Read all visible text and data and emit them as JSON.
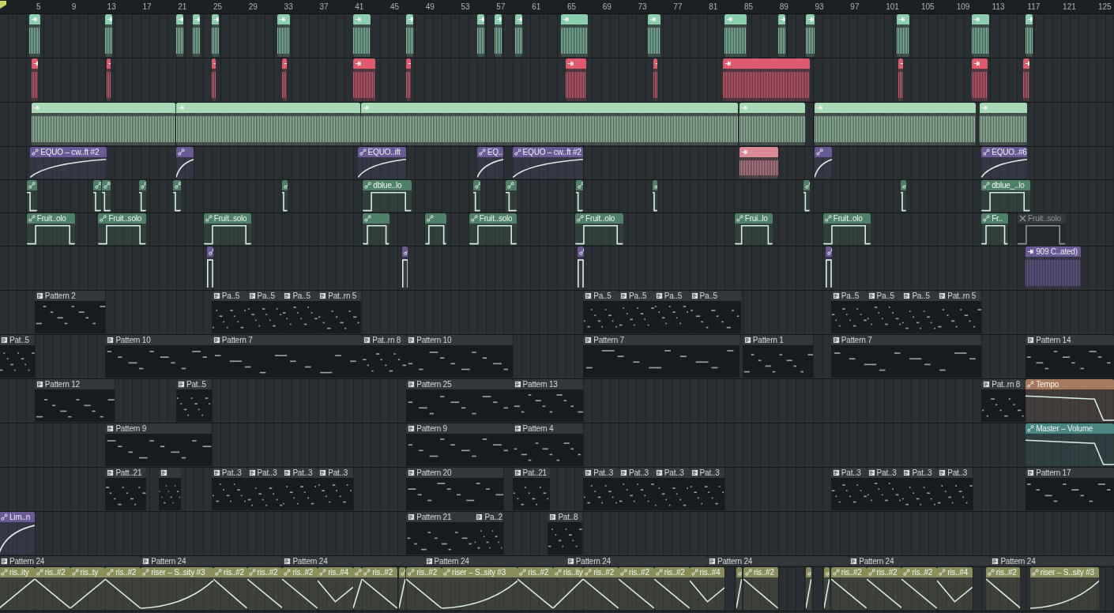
{
  "ruler": [
    "5",
    "9",
    "13",
    "17",
    "21",
    "25",
    "29",
    "33",
    "37",
    "41",
    "45",
    "49",
    "53",
    "57",
    "61",
    "65",
    "69",
    "73",
    "77",
    "81",
    "85",
    "89",
    "93",
    "97",
    "101",
    "105",
    "109",
    "113",
    "117",
    "121",
    "125"
  ],
  "tracks": [
    {
      "clips": [
        {
          "kind": "audio",
          "color": "#8ccfae"
        },
        {
          "kind": "audio",
          "color": "#8ccfae"
        },
        {
          "kind": "audio",
          "color": "#8ccfae"
        },
        {
          "kind": "audio",
          "color": "#8ccfae"
        },
        {
          "kind": "audio",
          "color": "#8ccfae"
        },
        {
          "kind": "audio",
          "color": "#8ccfae"
        },
        {
          "kind": "audio",
          "color": "#8ccfae"
        },
        {
          "kind": "audio",
          "color": "#8ccfae"
        },
        {
          "kind": "audio",
          "color": "#8ccfae"
        },
        {
          "kind": "audio",
          "color": "#8ccfae"
        },
        {
          "kind": "audio",
          "color": "#8ccfae"
        },
        {
          "kind": "audio",
          "color": "#8ccfae"
        },
        {
          "kind": "audio",
          "color": "#8ccfae"
        },
        {
          "kind": "audio",
          "color": "#8ccfae"
        },
        {
          "kind": "audio",
          "color": "#8ccfae"
        },
        {
          "kind": "audio",
          "color": "#8ccfae"
        },
        {
          "kind": "audio",
          "color": "#8ccfae"
        },
        {
          "kind": "audio",
          "color": "#8ccfae"
        },
        {
          "kind": "audio",
          "color": "#8ccfae"
        }
      ]
    },
    {
      "clips": [
        {
          "kind": "audio",
          "color": "#e05a6e"
        },
        {
          "kind": "audio",
          "color": "#e05a6e"
        },
        {
          "kind": "audio",
          "color": "#e05a6e"
        },
        {
          "kind": "audio",
          "color": "#e05a6e"
        },
        {
          "kind": "audio",
          "color": "#e05a6e"
        },
        {
          "kind": "audio",
          "color": "#e05a6e"
        },
        {
          "kind": "audio",
          "color": "#e05a6e"
        },
        {
          "kind": "audio",
          "color": "#e05a6e"
        },
        {
          "kind": "audio",
          "color": "#e05a6e"
        },
        {
          "kind": "audio",
          "color": "#e05a6e"
        },
        {
          "kind": "audio",
          "color": "#e05a6e"
        },
        {
          "kind": "audio",
          "color": "#e05a6e"
        }
      ]
    },
    {
      "clips": [
        {
          "kind": "audio",
          "color": "#a9d9b4"
        },
        {
          "kind": "audio",
          "color": "#a9d9b4"
        },
        {
          "kind": "audio",
          "color": "#a9d9b4"
        },
        {
          "kind": "audio",
          "color": "#a9d9b4"
        },
        {
          "kind": "audio",
          "color": "#a9d9b4"
        },
        {
          "kind": "audio",
          "color": "#a9d9b4"
        }
      ]
    },
    {
      "clips": [
        {
          "kind": "automation",
          "color": "#6a5a95",
          "label": "EQUO – cw..ft #2"
        },
        {
          "kind": "automation",
          "color": "#6a5a95"
        },
        {
          "kind": "automation",
          "color": "#6a5a95",
          "label": "EQUO..ift"
        },
        {
          "kind": "automation",
          "color": "#6a5a95",
          "label": "EQ.."
        },
        {
          "kind": "automation",
          "color": "#6a5a95",
          "label": "EQUO – cw..ft #2"
        },
        {
          "kind": "audio",
          "color": "#d98a95"
        },
        {
          "kind": "automation",
          "color": "#6a5a95"
        },
        {
          "kind": "automation",
          "color": "#6a5a95",
          "label": "EQUO..#6"
        }
      ]
    },
    {
      "clips": [
        {
          "kind": "automation",
          "color": "#4f8068"
        },
        {
          "kind": "automation",
          "color": "#4f8068"
        },
        {
          "kind": "automation",
          "color": "#4f8068"
        },
        {
          "kind": "automation",
          "color": "#4f8068"
        },
        {
          "kind": "automation",
          "color": "#4f8068"
        },
        {
          "kind": "automation",
          "color": "#4f8068"
        },
        {
          "kind": "automation",
          "color": "#4f8068",
          "label": "dblue..lo"
        },
        {
          "kind": "automation",
          "color": "#4f8068"
        },
        {
          "kind": "automation",
          "color": "#4f8068"
        },
        {
          "kind": "automation",
          "color": "#4f8068"
        },
        {
          "kind": "automation",
          "color": "#4f8068"
        },
        {
          "kind": "automation",
          "color": "#4f8068"
        },
        {
          "kind": "automation",
          "color": "#4f8068"
        },
        {
          "kind": "automation",
          "color": "#4f8068",
          "label": "dblue_..lo"
        }
      ]
    },
    {
      "clips": [
        {
          "kind": "automation",
          "color": "#4f8068",
          "muted": false,
          "label": "Fruit..olo"
        },
        {
          "kind": "automation",
          "color": "#4f8068",
          "muted": false,
          "label": "Fruit..solo"
        },
        {
          "kind": "automation",
          "color": "#4f8068",
          "muted": false,
          "label": "Fruit..solo"
        },
        {
          "kind": "automation",
          "color": "#4f8068",
          "muted": false
        },
        {
          "kind": "automation",
          "color": "#4f8068",
          "muted": false
        },
        {
          "kind": "automation",
          "color": "#4f8068",
          "muted": false,
          "label": "Fruit..solo"
        },
        {
          "kind": "automation",
          "color": "#4f8068",
          "muted": false,
          "label": "Fruit..olo"
        },
        {
          "kind": "automation",
          "color": "#4f8068",
          "muted": false,
          "label": "Frui..lo"
        },
        {
          "kind": "automation",
          "color": "#4f8068",
          "muted": false,
          "label": "Fruit..olo"
        },
        {
          "kind": "automation",
          "color": "#4f8068",
          "muted": false,
          "label": "Fr.."
        },
        {
          "kind": "automation",
          "muted": true,
          "label": "Fruit..solo"
        }
      ]
    },
    {
      "clips": [
        {
          "kind": "automation",
          "color": "#6a5a95"
        },
        {
          "kind": "automation",
          "color": "#6a5a95"
        },
        {
          "kind": "automation",
          "color": "#6a5a95"
        },
        {
          "kind": "automation",
          "color": "#6a5a95"
        },
        {
          "kind": "audio",
          "color": "#6a5a95",
          "label": "909 C..ated)"
        }
      ]
    },
    {
      "clips": [
        {
          "kind": "pattern",
          "label": "Pattern 2"
        },
        {
          "kind": "pattern",
          "label": "Pa..5"
        },
        {
          "kind": "pattern",
          "label": "Pa..5"
        },
        {
          "kind": "pattern",
          "label": "Pa..5"
        },
        {
          "kind": "pattern",
          "label": "Pat..rn 5"
        },
        {
          "kind": "pattern",
          "label": "Pa..5"
        },
        {
          "kind": "pattern",
          "label": "Pa..5"
        },
        {
          "kind": "pattern",
          "label": "Pa..5"
        },
        {
          "kind": "pattern",
          "label": "Pa..5"
        },
        {
          "kind": "pattern",
          "label": "Pa..5"
        },
        {
          "kind": "pattern",
          "label": "Pa..5"
        },
        {
          "kind": "pattern",
          "label": "Pa..5"
        },
        {
          "kind": "pattern",
          "label": "Pat..rn 5"
        }
      ]
    },
    {
      "clips": [
        {
          "kind": "pattern",
          "label": "Pat..5"
        },
        {
          "kind": "pattern",
          "label": "Pattern 10"
        },
        {
          "kind": "pattern",
          "label": "Pattern 7"
        },
        {
          "kind": "pattern",
          "label": "Pat..rn 8"
        },
        {
          "kind": "pattern",
          "label": "Pattern 10"
        },
        {
          "kind": "pattern",
          "label": "Pattern 7"
        },
        {
          "kind": "pattern",
          "label": "Pattern 1"
        },
        {
          "kind": "pattern",
          "label": "Pattern 7"
        },
        {
          "kind": "pattern",
          "label": "Pattern 14"
        }
      ]
    },
    {
      "clips": [
        {
          "kind": "pattern",
          "label": "Pattern 12"
        },
        {
          "kind": "pattern",
          "label": "Pat..5"
        },
        {
          "kind": "pattern",
          "label": "Pattern 25"
        },
        {
          "kind": "pattern",
          "label": "Pattern 13"
        },
        {
          "kind": "pattern",
          "label": "Pat..rn 8"
        },
        {
          "kind": "automation",
          "color": "#a57a5e",
          "label": "Tempo"
        }
      ]
    },
    {
      "clips": [
        {
          "kind": "pattern",
          "label": "Pattern 9"
        },
        {
          "kind": "pattern",
          "label": "Pattern 9"
        },
        {
          "kind": "pattern",
          "label": "Pattern 4"
        },
        {
          "kind": "automation",
          "color": "#4a8683",
          "label": "Master – Volume"
        }
      ]
    },
    {
      "clips": [
        {
          "kind": "pattern",
          "label": "Patt..21"
        },
        {
          "kind": "pattern"
        },
        {
          "kind": "pattern",
          "label": "Pat..3"
        },
        {
          "kind": "pattern",
          "label": "Pat..3"
        },
        {
          "kind": "pattern",
          "label": "Pat..3"
        },
        {
          "kind": "pattern",
          "label": "Pat..3"
        },
        {
          "kind": "pattern",
          "label": "Pattern 20"
        },
        {
          "kind": "pattern",
          "label": "Pat..21"
        },
        {
          "kind": "pattern",
          "label": "Pat..3"
        },
        {
          "kind": "pattern",
          "label": "Pat..3"
        },
        {
          "kind": "pattern",
          "label": "Pat..3"
        },
        {
          "kind": "pattern",
          "label": "Pat..3"
        },
        {
          "kind": "pattern",
          "label": "Pat..3"
        },
        {
          "kind": "pattern",
          "label": "Pat..3"
        },
        {
          "kind": "pattern",
          "label": "Pat..3"
        },
        {
          "kind": "pattern",
          "label": "Pat..3"
        },
        {
          "kind": "pattern",
          "label": "Pattern 17"
        }
      ]
    },
    {
      "clips": [
        {
          "kind": "automation",
          "color": "#6a5a95",
          "label": "Lim..n"
        },
        {
          "kind": "pattern",
          "label": "Pattern 21"
        },
        {
          "kind": "pattern",
          "label": "Pa..2"
        },
        {
          "kind": "pattern",
          "label": "Pat..8"
        }
      ]
    },
    {
      "clips": [
        {
          "kind": "pattern",
          "label": "Pattern 24"
        },
        {
          "kind": "pattern",
          "label": "Pattern 24"
        },
        {
          "kind": "pattern",
          "label": "Pattern 24"
        },
        {
          "kind": "pattern",
          "label": "Pattern 24"
        },
        {
          "kind": "pattern",
          "label": "Pattern 24"
        },
        {
          "kind": "pattern",
          "label": "Pattern 24"
        },
        {
          "kind": "pattern",
          "label": "Pattern 24"
        },
        {
          "kind": "pattern",
          "label": "Pattern 24"
        }
      ]
    },
    {
      "clips": [
        {
          "kind": "automation",
          "color": "#8a8e5b",
          "label": "ris..ity"
        },
        {
          "kind": "automation",
          "color": "#8a8e5b",
          "label": "ris..#2"
        },
        {
          "kind": "automation",
          "color": "#8a8e5b",
          "label": "ris..ty"
        },
        {
          "kind": "automation",
          "color": "#8a8e5b",
          "label": "ris..#2"
        },
        {
          "kind": "automation",
          "color": "#8a8e5b",
          "label": "riser – S..sity #3"
        },
        {
          "kind": "automation",
          "color": "#8a8e5b",
          "label": "ris..#2"
        },
        {
          "kind": "automation",
          "color": "#8a8e5b",
          "label": "ris..#2"
        },
        {
          "kind": "automation",
          "color": "#8a8e5b",
          "label": "ris..#2"
        },
        {
          "kind": "automation",
          "color": "#8a8e5b",
          "label": "ris..#4"
        },
        {
          "kind": "automation",
          "color": "#8a8e5b"
        },
        {
          "kind": "automation",
          "color": "#8a8e5b",
          "label": "ris..#2"
        },
        {
          "kind": "automation",
          "color": "#8a8e5b"
        },
        {
          "kind": "automation",
          "color": "#8a8e5b",
          "label": "ris..#2"
        },
        {
          "kind": "automation",
          "color": "#8a8e5b",
          "label": "riser – S..sity #3"
        },
        {
          "kind": "automation",
          "color": "#8a8e5b",
          "label": "ris..#2"
        },
        {
          "kind": "automation",
          "color": "#8a8e5b",
          "label": "ris..ity"
        },
        {
          "kind": "automation",
          "color": "#8a8e5b",
          "label": "ris..#2"
        },
        {
          "kind": "automation",
          "color": "#8a8e5b",
          "label": "ris..#2"
        },
        {
          "kind": "automation",
          "color": "#8a8e5b",
          "label": "ris..#2"
        },
        {
          "kind": "automation",
          "color": "#8a8e5b",
          "label": "ris..#4"
        },
        {
          "kind": "automation",
          "color": "#8a8e5b"
        },
        {
          "kind": "automation",
          "color": "#8a8e5b",
          "label": "ris..#2"
        },
        {
          "kind": "automation",
          "color": "#8a8e5b"
        },
        {
          "kind": "automation",
          "color": "#8a8e5b"
        },
        {
          "kind": "automation",
          "color": "#8a8e5b",
          "label": "ris..#2"
        },
        {
          "kind": "automation",
          "color": "#8a8e5b",
          "label": "ris..#2"
        },
        {
          "kind": "automation",
          "color": "#8a8e5b",
          "label": "ris..#2"
        },
        {
          "kind": "automation",
          "color": "#8a8e5b",
          "label": "ris..#4"
        },
        {
          "kind": "automation",
          "color": "#8a8e5b",
          "label": "ris..#2"
        },
        {
          "kind": "automation",
          "color": "#8a8e5b",
          "label": "riser – S..sity #3"
        }
      ]
    }
  ]
}
